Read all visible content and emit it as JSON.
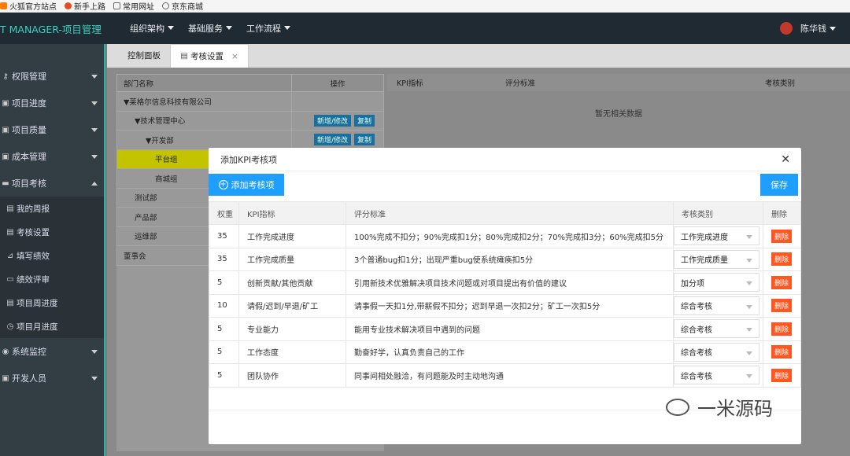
{
  "bookmarks": [
    "火狐官方站点",
    "新手上路",
    "常用网址",
    "京东商城"
  ],
  "brand": "T MANAGER-项目管理",
  "topnav": [
    "组织架构",
    "基础服务",
    "工作流程"
  ],
  "user": "陈华钱",
  "sidebar": {
    "items": [
      {
        "label": "权限管理",
        "icon": "key-icon"
      },
      {
        "label": "项目进度",
        "icon": "progress-icon"
      },
      {
        "label": "项目质量",
        "icon": "quality-icon"
      },
      {
        "label": "成本管理",
        "icon": "cost-icon"
      },
      {
        "label": "项目考核",
        "icon": "assess-icon"
      }
    ],
    "sub": [
      {
        "label": "我的周报",
        "icon": "calendar-icon"
      },
      {
        "label": "考核设置",
        "icon": "doc-icon"
      },
      {
        "label": "填写绩效",
        "icon": "chart-icon"
      },
      {
        "label": "绩效评审",
        "icon": "review-icon"
      },
      {
        "label": "项目周进度",
        "icon": "list-icon"
      },
      {
        "label": "项目月进度",
        "icon": "clock-icon"
      }
    ],
    "bottom": [
      {
        "label": "系统监控",
        "icon": "monitor-icon"
      },
      {
        "label": "开发人员",
        "icon": "people-icon"
      }
    ]
  },
  "tabs": [
    "控制面板",
    "考核设置"
  ],
  "tree": {
    "head_name": "部门名称",
    "head_op": "操作",
    "rows": [
      {
        "name": "▼莱格尔信息科技有限公司"
      },
      {
        "name": "▼技术管理中心"
      },
      {
        "name": "▼开发部"
      },
      {
        "name": "平台组"
      },
      {
        "name": "商城组"
      },
      {
        "name": "测试部"
      },
      {
        "name": "产品部"
      },
      {
        "name": "运维部"
      },
      {
        "name": "董事会"
      }
    ],
    "btn_edit": "新增/修改",
    "btn_copy": "复制"
  },
  "kpi_head": [
    "KPI指标",
    "评分标准",
    "考核类别"
  ],
  "nodata": "暂无相关数据",
  "modal": {
    "title": "添加KPI考核项",
    "add": "添加考核项",
    "save": "保存",
    "cols": [
      "权重",
      "KPI指标",
      "评分标准",
      "考核类别",
      "删除"
    ],
    "del": "删除",
    "rows": [
      {
        "w": "35",
        "kpi": "工作完成进度",
        "std": "100%完成不扣分；90%完成扣1分；80%完成扣2分；70%完成扣3分；60%完成扣5分",
        "cat": "工作完成进度"
      },
      {
        "w": "35",
        "kpi": "工作完成质量",
        "std": "3个普通bug扣1分；出现严重bug使系统瘫痪扣5分",
        "cat": "工作完成质量"
      },
      {
        "w": "5",
        "kpi": "创新贡献/其他贡献",
        "std": "引用新技术优雅解决项目技术问题或对项目提出有价值的建议",
        "cat": "加分项"
      },
      {
        "w": "10",
        "kpi": "请假/迟到/早退/矿工",
        "std": "请事假一天扣1分,带薪假不扣分；迟到早退一次扣2分；矿工一次扣5分",
        "cat": "综合考核"
      },
      {
        "w": "5",
        "kpi": "专业能力",
        "std": "能用专业技术解决项目中遇到的问题",
        "cat": "综合考核"
      },
      {
        "w": "5",
        "kpi": "工作态度",
        "std": "勤奋好学，认真负责自己的工作",
        "cat": "综合考核"
      },
      {
        "w": "5",
        "kpi": "团队协作",
        "std": "同事间相处融洽，有问题能及时主动地沟通",
        "cat": "综合考核"
      }
    ]
  },
  "watermark": "一米源码"
}
